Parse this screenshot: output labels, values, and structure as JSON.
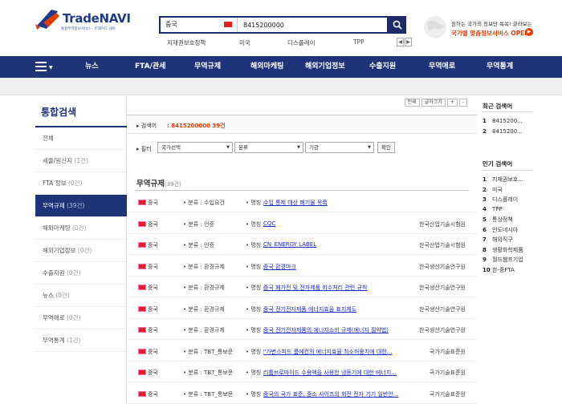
{
  "header": {
    "logo_text_trade": "Trade",
    "logo_text_navi": "NAVI",
    "logo_sub": "통합무역정보서비스 · 트레이드 내비",
    "search": {
      "country": "중국",
      "query": "8415200000"
    },
    "keywords": [
      "지재권보호정책",
      "미국",
      "디스플레이",
      "TPP"
    ],
    "promo": {
      "line1": "원하는 국가의 정보만 쏙쏙! 골라보는",
      "line2": "국가별 맞춤정보서비스 OPEN",
      "accent": "#e03c00"
    }
  },
  "nav": {
    "items": [
      "뉴스",
      "FTA/관세",
      "무역규제",
      "해외마케팅",
      "해외기업정보",
      "수출지원",
      "무역애로",
      "무역통계"
    ],
    "bg": "#1e3378"
  },
  "sidebar": {
    "title": "통합검색",
    "items": [
      {
        "label": "전체",
        "count": ""
      },
      {
        "label": "세율/원산지",
        "count": "(1건)"
      },
      {
        "label": "FTA 정보",
        "count": "(0건)"
      },
      {
        "label": "무역규제",
        "count": "(39건)"
      },
      {
        "label": "해외마케팅",
        "count": "(0건)"
      },
      {
        "label": "해외기업정보",
        "count": "(0건)"
      },
      {
        "label": "수출지원",
        "count": "(0건)"
      },
      {
        "label": "뉴스",
        "count": "(0건)"
      },
      {
        "label": "무역애로",
        "count": "(0건)"
      },
      {
        "label": "무역통계",
        "count": "(1건)"
      }
    ]
  },
  "main": {
    "tools": {
      "print": "인쇄",
      "fontsize": "글자크기",
      "plus": "+",
      "minus": "-"
    },
    "result_label": "검색어",
    "result_value": "8415200000 39건",
    "filter_label": "필터",
    "filters": [
      "국가선택",
      "분류",
      "기관"
    ],
    "confirm": "확인",
    "section_title": "무역규제",
    "section_count": "(39건)",
    "rows": [
      {
        "country": "중국",
        "cat": "• 분류 : 수입요건",
        "title_label": "• 명칭 :",
        "title": "수입 통제 대상 폐기물 목록",
        "org": ""
      },
      {
        "country": "중국",
        "cat": "• 분류 : 인증",
        "title_label": "• 명칭 :",
        "title": "CQC",
        "org": "한국산업기술시험원"
      },
      {
        "country": "중국",
        "cat": "• 분류 : 인증",
        "title_label": "• 명칭 :",
        "title": "CN_ENERGY LABEL",
        "org": "한국산업기술시험원"
      },
      {
        "country": "중국",
        "cat": "• 분류 : 환경규제",
        "title_label": "• 명칭 :",
        "title": "중국 환경마크",
        "org": "한국생산기술연구원"
      },
      {
        "country": "중국",
        "cat": "• 분류 : 환경규제",
        "title_label": "• 명칭 :",
        "title": "중국 폐가전 및 전자제품 회수처리 관련 규칙",
        "org": "한국생산기술연구원"
      },
      {
        "country": "중국",
        "cat": "• 분류 : 환경규제",
        "title_label": "• 명칭 :",
        "title": "중국 전기전자제품 에너지효율 표지제도",
        "org": "한국생산기술연구원"
      },
      {
        "country": "중국",
        "cat": "• 분류 : 환경규제",
        "title_label": "• 명칭 :",
        "title": "중국 전기전자제품의 에너지소비 규제(에너지 절약법)",
        "org": "한국생산기술연구원"
      },
      {
        "country": "중국",
        "cat": "• 분류 : TBT_통보문",
        "title_label": "• 명칭 :",
        "title": "\"가변스피드 룸에컨의 에너지효율 최소허용치에 대한...",
        "org": "국가기술표준원"
      },
      {
        "country": "중국",
        "cat": "• 분류 : TBT_통보문",
        "title_label": "• 명칭 :",
        "title": "리튬브로마이드 수용액을 사용한 냉동기에 대한 에너지...",
        "org": "국가기술표준원"
      },
      {
        "country": "중국",
        "cat": "• 분류 : TBT_통보문",
        "title_label": "• 명칭 :",
        "title": "중국의 국가 표준, 중소 사이즈의 회전 전자 기기 일반안...",
        "org": "국가기술표준원"
      }
    ]
  },
  "right": {
    "recent_title": "최근 검색어",
    "recent": [
      {
        "n": "1",
        "t": "8415200..."
      },
      {
        "n": "2",
        "t": "8415200..."
      }
    ],
    "popular_title": "인기 검색어",
    "popular": [
      {
        "n": "1",
        "t": "지재권보호..."
      },
      {
        "n": "2",
        "t": "미국"
      },
      {
        "n": "3",
        "t": "디스플레이"
      },
      {
        "n": "4",
        "t": "TPP"
      },
      {
        "n": "5",
        "t": "통상정책"
      },
      {
        "n": "6",
        "t": "인도네시아"
      },
      {
        "n": "7",
        "t": "해외직구"
      },
      {
        "n": "8",
        "t": "생활화학제품"
      },
      {
        "n": "9",
        "t": "월드챔프기업"
      },
      {
        "n": "10",
        "t": "한-중FTA"
      }
    ]
  }
}
